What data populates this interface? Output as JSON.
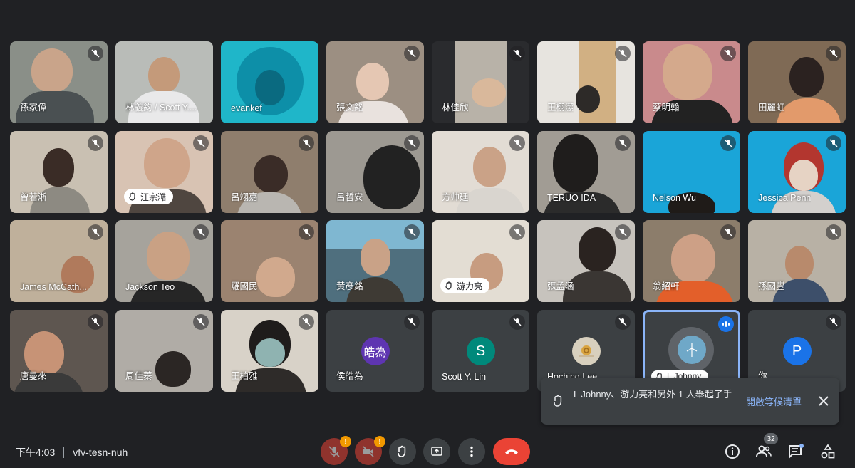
{
  "participants": [
    {
      "name": "孫家偉",
      "hand": false
    },
    {
      "name": "林義鈞 / Scott Y....",
      "hand": false
    },
    {
      "name": "evankef",
      "hand": false
    },
    {
      "name": "張文銘",
      "hand": false
    },
    {
      "name": "林佳欣",
      "hand": false
    },
    {
      "name": "王栩潔",
      "hand": false
    },
    {
      "name": "蔡明翰",
      "hand": false
    },
    {
      "name": "田麗虹",
      "hand": false
    },
    {
      "name": "曾若淅",
      "hand": false
    },
    {
      "name": "汪宗澔",
      "hand": true
    },
    {
      "name": "呂翊嘉",
      "hand": false
    },
    {
      "name": "呂哲安",
      "hand": false
    },
    {
      "name": "方帅廷",
      "hand": false
    },
    {
      "name": "TERUO IDA",
      "hand": false
    },
    {
      "name": "Nelson Wu",
      "hand": false
    },
    {
      "name": "Jessica Penn",
      "hand": false
    },
    {
      "name": "James McCath...",
      "hand": false
    },
    {
      "name": "Jackson Teo",
      "hand": false
    },
    {
      "name": "羅國民",
      "hand": false
    },
    {
      "name": "黃彥銘",
      "hand": false
    },
    {
      "name": "游力亮",
      "hand": true
    },
    {
      "name": "張孟涵",
      "hand": false
    },
    {
      "name": "翁紹軒",
      "hand": false
    },
    {
      "name": "孫國豐",
      "hand": false
    },
    {
      "name": "唐曼來",
      "hand": false
    },
    {
      "name": "周佳蓁",
      "hand": false
    },
    {
      "name": "王柏雅",
      "hand": false
    },
    {
      "name": "侯皓為",
      "hand": false,
      "initial": "皓為",
      "avatar_color": "#5e35b1"
    },
    {
      "name": "Scott Y. Lin",
      "hand": false,
      "initial": "S",
      "avatar_color": "#00897b"
    },
    {
      "name": "Hoching Lee",
      "hand": false
    },
    {
      "name": "L Johnny",
      "hand": true
    },
    {
      "name": "你",
      "hand": false,
      "initial": "P",
      "avatar_color": "#1a73e8"
    }
  ],
  "toast": {
    "message": "L Johnny、游力亮和另外 1 人舉起了手",
    "action": "開啟等候清單"
  },
  "bottom_bar": {
    "time": "下午4:03",
    "meeting_code": "vfv-tesn-nuh",
    "warning_mark": "!",
    "participant_count": "32"
  },
  "colors": {
    "background": "#202124",
    "tile": "#3c4043",
    "accent": "#8ab4f8",
    "end_call": "#ea4335",
    "warning": "#f29900"
  }
}
